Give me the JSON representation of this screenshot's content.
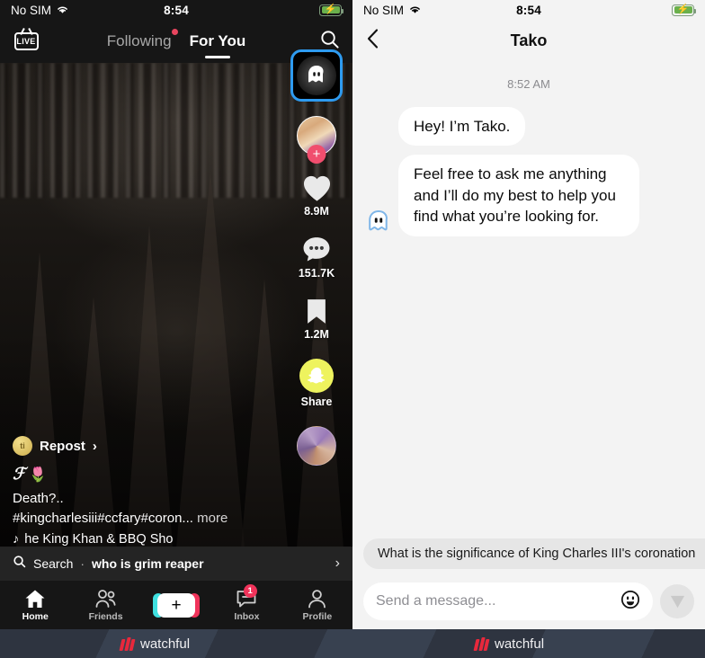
{
  "left": {
    "status": {
      "carrier": "No SIM",
      "wifi_icon": "wifi-icon",
      "time": "8:54",
      "battery_icon": "battery-charging-icon"
    },
    "header": {
      "live_label": "LIVE",
      "tab_following": "Following",
      "tab_for_you": "For You",
      "search_icon": "search-icon"
    },
    "rail": {
      "tako_icon": "tako-ghost-icon",
      "avatar": "creator-avatar",
      "follow_plus": "+",
      "like_count": "8.9M",
      "comment_count": "151.7K",
      "bookmark_count": "1.2M",
      "share_label": "Share",
      "share_icon": "snapchat-icon",
      "music_disc": "music-disc"
    },
    "caption": {
      "repost_avatar_text": "ti",
      "repost_label": "Repost",
      "repost_chevron": "›",
      "handle": "ℱ",
      "handle_emoji": "🌷",
      "text": "Death?..",
      "hashtags": "#kingcharlesiii#ccfary#coron...",
      "more": "more",
      "music_note": "♪",
      "music": "he King Khan & BBQ Sho"
    },
    "search_strip": {
      "icon": "search-icon",
      "label": "Search",
      "separator": "·",
      "query": "who is grim reaper",
      "chevron": "›"
    },
    "nav": [
      {
        "label": "Home",
        "icon": "home-icon",
        "active": true
      },
      {
        "label": "Friends",
        "icon": "friends-icon",
        "active": false
      },
      {
        "label": "",
        "icon": "create-plus-icon",
        "active": false
      },
      {
        "label": "Inbox",
        "icon": "inbox-icon",
        "badge": "1",
        "active": false
      },
      {
        "label": "Profile",
        "icon": "profile-icon",
        "active": false
      }
    ]
  },
  "right": {
    "status": {
      "carrier": "No SIM",
      "wifi_icon": "wifi-icon",
      "time": "8:54",
      "battery_icon": "battery-charging-icon"
    },
    "header": {
      "back_icon": "back-chevron-icon",
      "title": "Tako"
    },
    "chat": {
      "timestamp": "8:52 AM",
      "messages": [
        {
          "sender": "tako",
          "text": "Hey! I’m Tako.",
          "avatar": false
        },
        {
          "sender": "tako",
          "text": "Feel free to ask me anything and I’ll do my best to help you find what you’re looking for.",
          "avatar": true
        }
      ]
    },
    "suggestion_chip": "What is the significance of King Charles III's coronation",
    "composer": {
      "placeholder": "Send a message...",
      "emoji_icon": "smiley-icon",
      "send_icon": "send-icon"
    }
  },
  "footer": {
    "brand": "watchful",
    "logo_icon": "watchful-logo-icon"
  },
  "colors": {
    "tiktok_bg": "#161616",
    "chat_bg": "#f3f3f3",
    "bubble": "#ffffff",
    "accent_blue": "#2e9bf0",
    "accent_red": "#f0335a",
    "snap_yellow": "#eef35e",
    "watchful_red": "#e8283c",
    "footer_bg": "#2e3440"
  }
}
